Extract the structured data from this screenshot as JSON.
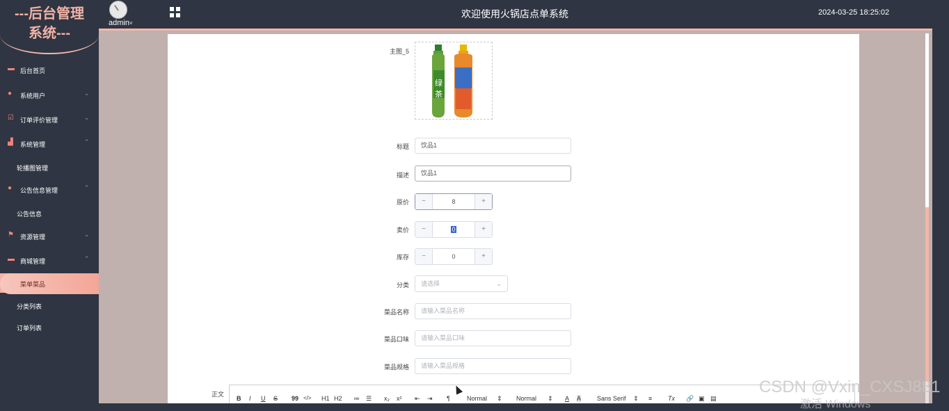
{
  "header": {
    "logo_line1": "---后台管理",
    "logo_line2": "系统---",
    "user": "admin",
    "user_caret": "˅",
    "title": "欢迎使用火锅店点单系统",
    "datetime": "2024-03-25 18:25:02"
  },
  "sidebar": {
    "items": [
      {
        "label": "后台首页",
        "icon": "monitor-icon"
      },
      {
        "label": "系统用户",
        "icon": "user-icon",
        "arrow": "⌄"
      },
      {
        "label": "订单评价管理",
        "icon": "checkbox-icon",
        "arrow": "⌄"
      },
      {
        "label": "系统管理",
        "icon": "bar-chart-icon",
        "arrow": "⌃"
      },
      {
        "label": "轮播图管理"
      },
      {
        "label": "公告信息管理",
        "icon": "info-icon",
        "arrow": "⌃"
      },
      {
        "label": "公告信息"
      },
      {
        "label": "资源管理",
        "icon": "flag-icon",
        "arrow": "⌄"
      },
      {
        "label": "商城管理",
        "icon": "shop-icon",
        "arrow": "⌃"
      },
      {
        "label": "菜单菜品"
      },
      {
        "label": "分类列表"
      },
      {
        "label": "订单列表"
      }
    ]
  },
  "form": {
    "image_label": "主图_5",
    "title_label": "标题",
    "title_value": "饮品1",
    "desc_label": "描述",
    "desc_value": "饮品1",
    "orig_price_label": "原价",
    "orig_price_value": "8",
    "sale_price_label": "卖价",
    "sale_price_value": "0",
    "stock_label": "库存",
    "stock_value": "0",
    "category_label": "分类",
    "category_placeholder": "请选择",
    "dish_name_label": "菜品名称",
    "dish_name_placeholder": "请输入菜品名称",
    "dish_taste_label": "菜品口味",
    "dish_taste_placeholder": "请输入菜品口味",
    "dish_spec_label": "菜品规格",
    "dish_spec_placeholder": "请输入菜品规格",
    "body_label": "正文",
    "minus": "−",
    "plus": "+",
    "chevron": "⌄"
  },
  "editor_toolbar": {
    "bold": "B",
    "italic": "I",
    "underline": "U",
    "strike": "S",
    "quote": "99",
    "code": "</>",
    "h1": "H1",
    "h2": "H2",
    "ordered": "≔",
    "bullet": "☰",
    "sub": "x₂",
    "sup": "x²",
    "outdent": "⇤",
    "indent": "⇥",
    "direction": "¶",
    "size1": "Normal",
    "size2": "Normal",
    "color": "A",
    "bg": "A",
    "font": "Sans Serif",
    "align": "≡",
    "clean": "Tx",
    "link": "🔗",
    "image": "▣",
    "video": "▤",
    "updown": "⇕"
  },
  "overlay": {
    "watermark": "CSDN @Vxin_CXSJ881",
    "activate": "激活 Windows"
  },
  "colors": {
    "sidebar_bg": "#2f3542",
    "accent": "#f3b6aa",
    "content_bg": "#c0b1ae"
  }
}
